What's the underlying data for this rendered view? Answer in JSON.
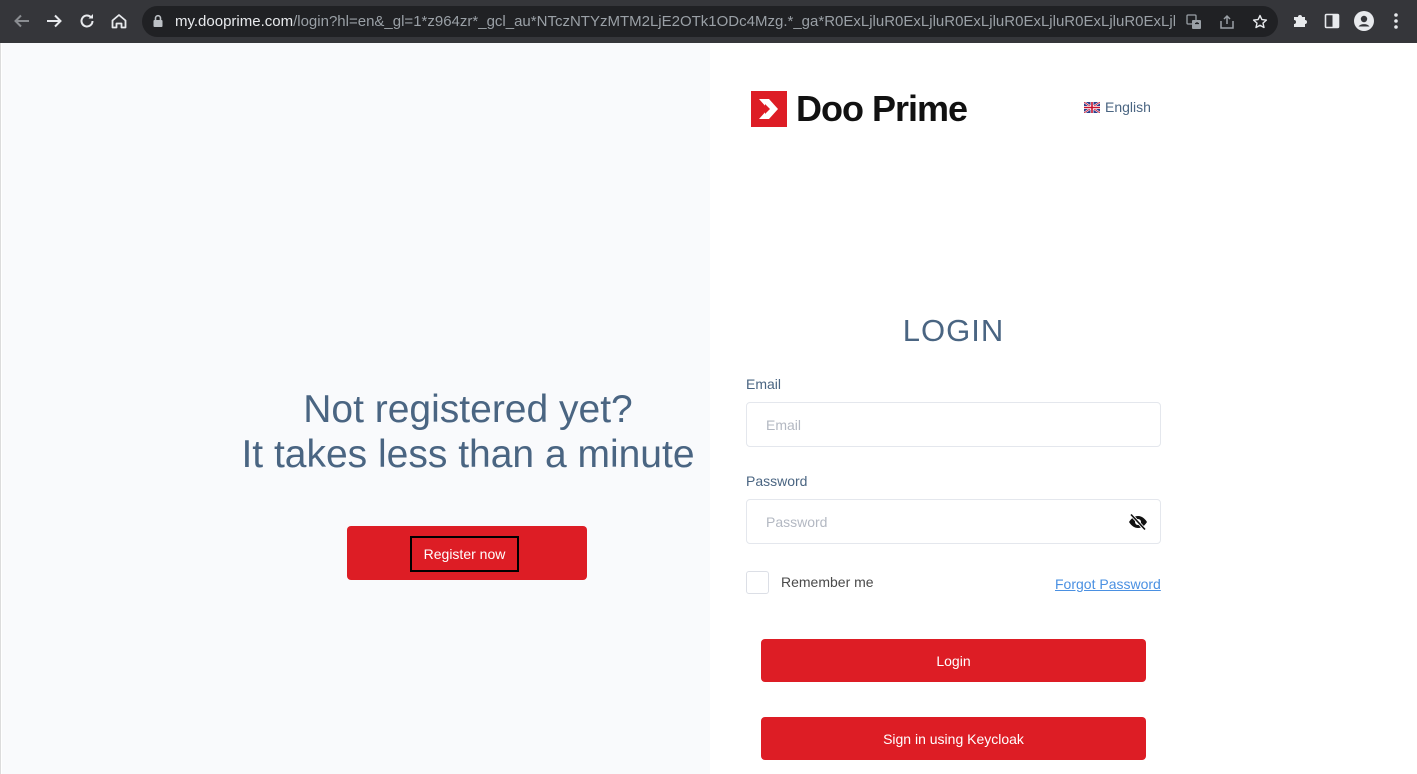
{
  "browser": {
    "url_host": "my.dooprime.com",
    "url_path": "/login?hl=en&_gl=1*z964zr*_gcl_au*NTczNTYzMTM2LjE2OTk1ODc4Mzg.*_ga*R0ExLjluR0ExLjluR0ExLjluR0ExLjluR0ExLjluR0ExLjlu..."
  },
  "brand": {
    "name": "Doo Prime",
    "accent": "#dd1d25"
  },
  "language": {
    "label": "English"
  },
  "promo": {
    "line1": "Not registered yet?",
    "line2": "It takes less than a minute",
    "register_label": "Register now"
  },
  "login": {
    "title": "LOGIN",
    "email_label": "Email",
    "email_placeholder": "Email",
    "email_value": "",
    "password_label": "Password",
    "password_placeholder": "Password",
    "password_value": "",
    "remember_label": "Remember me",
    "forgot_label": "Forgot Password",
    "login_button": "Login",
    "keycloak_button": "Sign in using Keycloak"
  },
  "colors": {
    "text": "#4a6582",
    "panel": "#f9fafc",
    "chrome": "#35363a"
  }
}
